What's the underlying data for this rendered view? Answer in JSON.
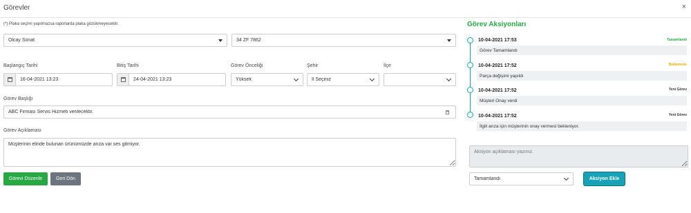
{
  "header": {
    "title": "Görevler",
    "close": "×"
  },
  "note": "(*) Plaka seçimi yapılmazsa raporlarda plaka gözükmeyecektir.",
  "selects": {
    "person": "Olcay Sonat",
    "plate": "34 ZF 7862"
  },
  "fields": {
    "start_label": "Başlangıç Tarihi",
    "start_value": "16-04-2021 13:23",
    "end_label": "Bitiş Tarihi",
    "end_value": "24-04-2021 13:23",
    "priority_label": "Görev Önceliği",
    "priority_value": "Yüksek",
    "city_label": "Şehir",
    "city_value": "İl Seçiniz",
    "district_label": "İlçe",
    "district_value": "",
    "title_label": "Görev Başlığı",
    "title_value": "ABC Firması Servis Hizmeti verilecektir.",
    "desc_label": "Görev Açıklaması",
    "desc_value": "Müşterinin elinde bulunan ürünümüzde arıza var ses gitmiyor."
  },
  "buttons": {
    "edit": "Görevi Düzenle",
    "back": "Geri Dön",
    "add_action": "Aksiyon Ekle"
  },
  "actions": {
    "title": "Görev Aksiyonları",
    "items": [
      {
        "date": "10-04-2021 17:53",
        "status": "Tamamlandı",
        "status_color": "#28a745",
        "desc": "Görev Tamamlandı"
      },
      {
        "date": "10-04-2021 17:52",
        "status": "Beklemede",
        "status_color": "#f0ad00",
        "desc": "Parça değişimi yapıldı"
      },
      {
        "date": "10-04-2021 17:52",
        "status": "Yeni Görev",
        "status_color": "#333333",
        "desc": "Müşteri Onay verdi"
      },
      {
        "date": "10-04-2021 17:52",
        "status": "Yeni Görev",
        "status_color": "#333333",
        "desc": "İlgili arıza için müşterinin onay vermesi bekleniyor."
      }
    ],
    "input_placeholder": "Aksiyon açıklaması yazınız.",
    "status_select": "Tamamlandı"
  },
  "colors": {
    "accent_green": "#28a745",
    "accent_teal": "#17a2b8",
    "button_gray": "#6c757d"
  }
}
